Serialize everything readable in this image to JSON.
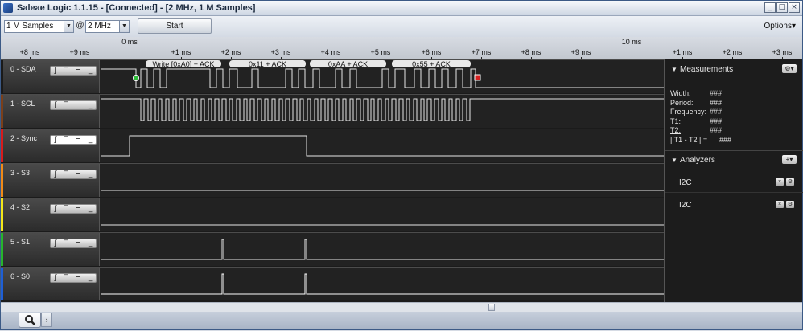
{
  "window": {
    "title": "Saleae Logic 1.1.15 - [Connected] - [2 MHz, 1 M Samples]"
  },
  "toolbar": {
    "samples": "1 M Samples",
    "at": "@",
    "rate": "2 MHz",
    "start_label": "Start",
    "options_label": "Options▾"
  },
  "ruler": {
    "major": [
      "0 ms",
      "10 ms"
    ],
    "minor_left": [
      "+8 ms",
      "+9 ms",
      "+1 ms",
      "+2 ms",
      "+3 ms",
      "+4 ms",
      "+5 ms",
      "+6 ms",
      "+7 ms",
      "+8 ms",
      "+9 ms",
      "+1 ms",
      "+2 ms",
      "+3 ms"
    ]
  },
  "channels": [
    {
      "name": "0 - SDA",
      "color": "#1a1a1a"
    },
    {
      "name": "1 - SCL",
      "color": "#7a3f1a"
    },
    {
      "name": "2 - Sync",
      "color": "#d81b1b"
    },
    {
      "name": "3 - S3",
      "color": "#f08a17"
    },
    {
      "name": "4 - S2",
      "color": "#f3e61a"
    },
    {
      "name": "5 - S1",
      "color": "#27b42c"
    },
    {
      "name": "6 - S0",
      "color": "#1e5fd6"
    }
  ],
  "trigger_icons": [
    "rising-edge-icon",
    "high-icon",
    "falling-edge-icon",
    "low-icon"
  ],
  "decoded": [
    "Write [0xA0] + ACK",
    "0x11 + ACK",
    "0xAA + ACK",
    "0x55 + ACK"
  ],
  "measurements": {
    "title": "Measurements",
    "rows": [
      {
        "label": "Width:",
        "value": "###"
      },
      {
        "label": "Period:",
        "value": "###"
      },
      {
        "label": "Frequency:",
        "value": "###"
      },
      {
        "label": "T1:",
        "value": "###"
      },
      {
        "label": "T2:",
        "value": "###"
      },
      {
        "label": "| T1 - T2 | =",
        "value": "###"
      }
    ]
  },
  "analyzers": {
    "title": "Analyzers",
    "items": [
      "I2C",
      "I2C"
    ]
  }
}
